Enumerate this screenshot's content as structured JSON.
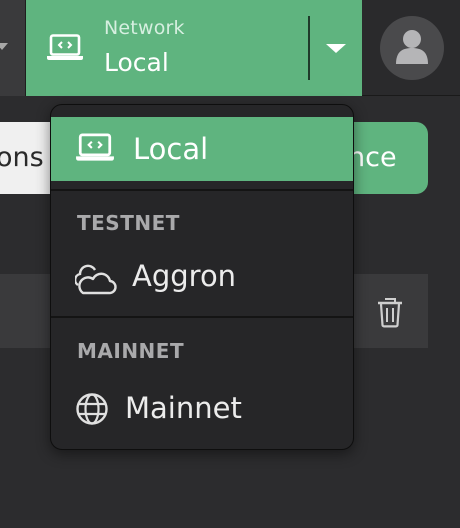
{
  "header": {
    "network_label": "Network",
    "network_value": "Local",
    "network_icon": "laptop-code-icon",
    "avatar_icon": "user-icon"
  },
  "background": {
    "left_pill_text": "ons",
    "right_pill_text": "nce",
    "row_icon": "trash-icon"
  },
  "network_menu": {
    "selected": "Local",
    "local_item": {
      "label": "Local",
      "icon": "laptop-code-icon"
    },
    "sections": [
      {
        "header": "TESTNET",
        "items": [
          {
            "label": "Aggron",
            "icon": "cloud-icon"
          }
        ]
      },
      {
        "header": "MAINNET",
        "items": [
          {
            "label": "Mainnet",
            "icon": "globe-icon"
          }
        ]
      }
    ]
  },
  "colors": {
    "accent_green": "#5fb47f",
    "background": "#2c2c2e",
    "menu_background": "#262628"
  }
}
